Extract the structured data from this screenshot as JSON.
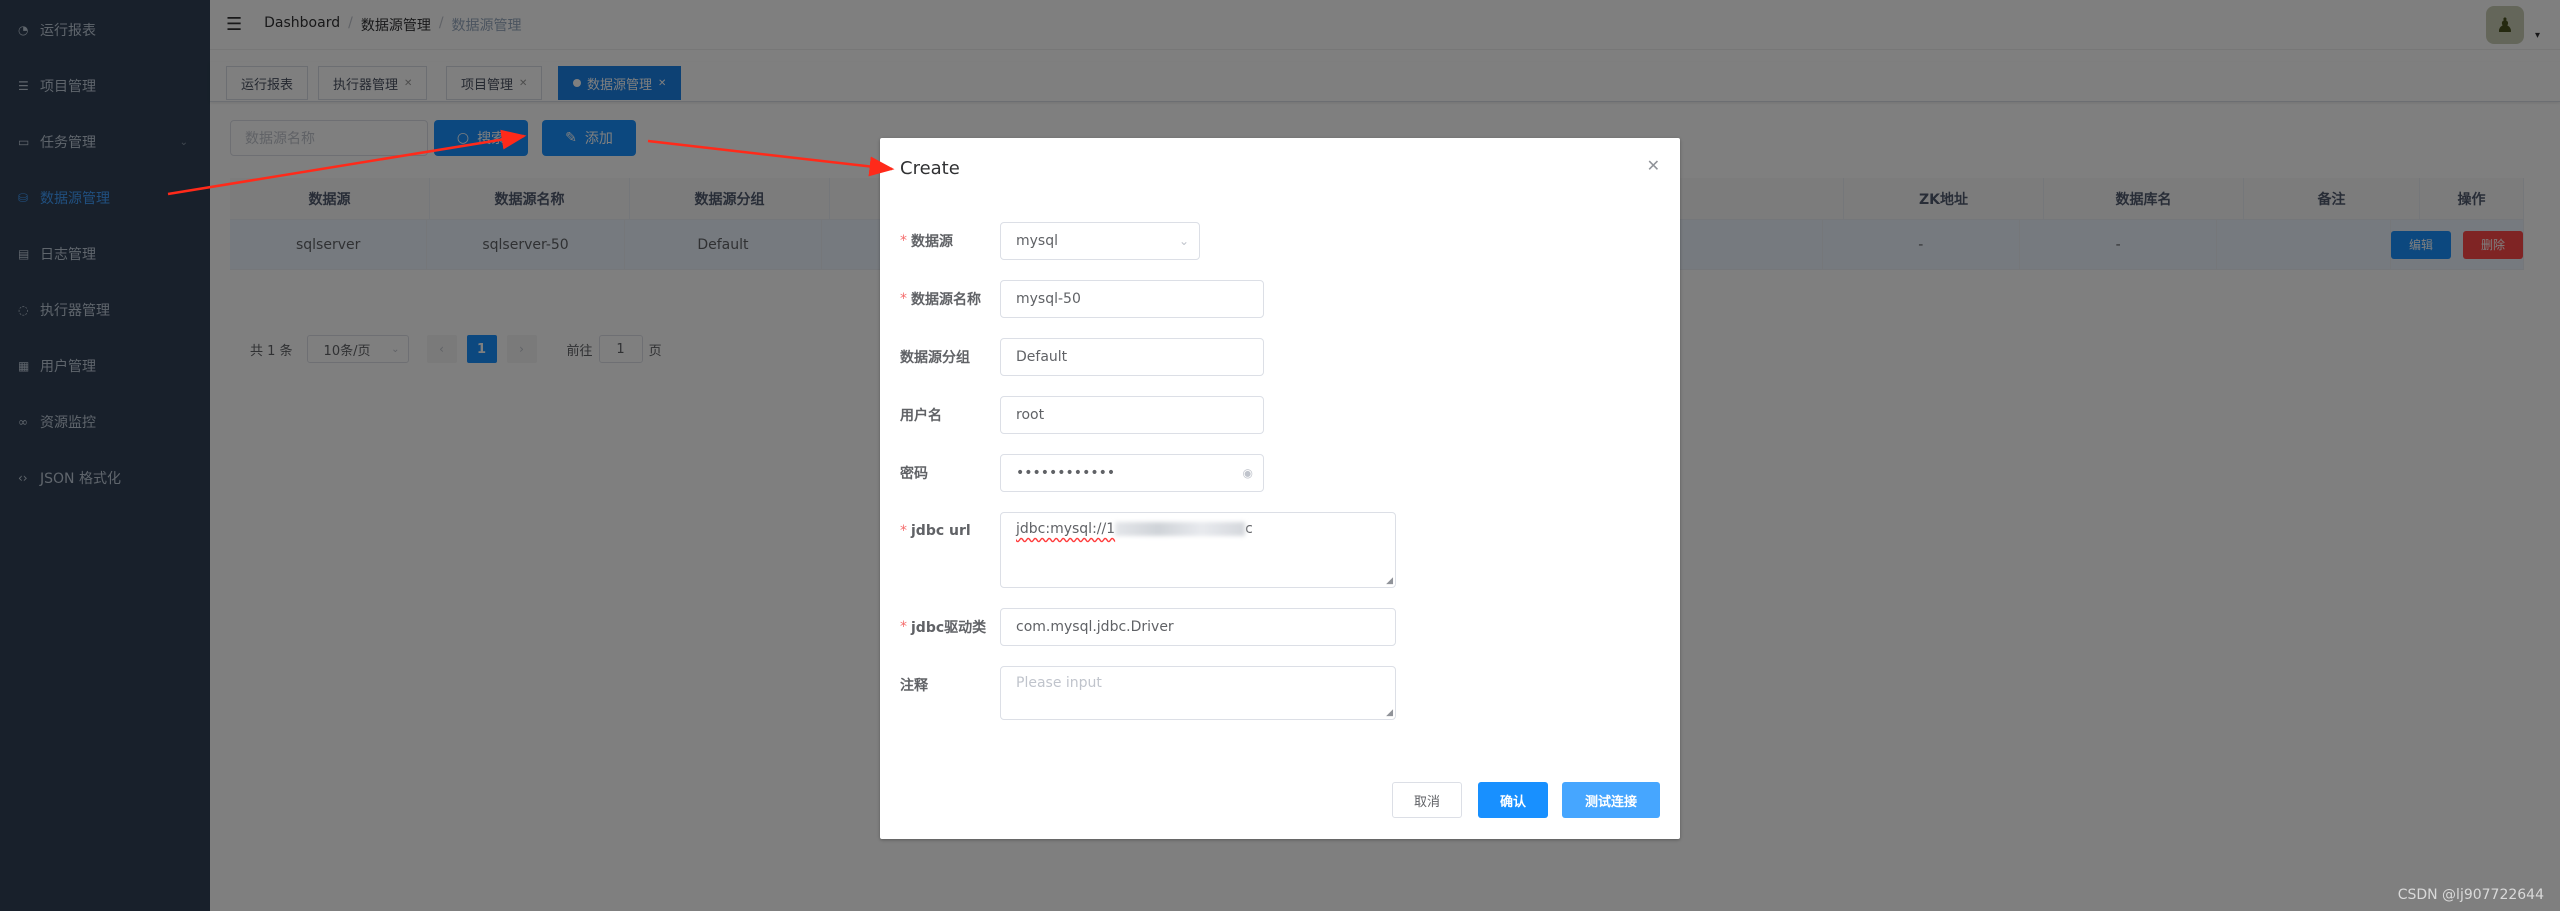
{
  "sidebar": {
    "items": [
      {
        "label": "运行报表",
        "icon": "dashboard-icon"
      },
      {
        "label": "项目管理",
        "icon": "database-icon"
      },
      {
        "label": "任务管理",
        "icon": "monitor-icon"
      },
      {
        "label": "数据源管理",
        "icon": "datasource-icon"
      },
      {
        "label": "日志管理",
        "icon": "log-icon"
      },
      {
        "label": "执行器管理",
        "icon": "executor-icon"
      },
      {
        "label": "用户管理",
        "icon": "user-table-icon"
      },
      {
        "label": "资源监控",
        "icon": "link-icon"
      },
      {
        "label": "JSON 格式化",
        "icon": "code-icon"
      }
    ],
    "active_index": 3
  },
  "header": {
    "breadcrumb": [
      "Dashboard",
      "数据源管理",
      "数据源管理"
    ]
  },
  "tags": [
    {
      "label": "运行报表"
    },
    {
      "label": "执行器管理"
    },
    {
      "label": "项目管理"
    },
    {
      "label": "数据源管理"
    }
  ],
  "filter": {
    "placeholder": "数据源名称",
    "search_label": "搜索",
    "add_label": "添加"
  },
  "table": {
    "headers": [
      "数据源",
      "数据源名称",
      "数据源分组",
      "ZK地址",
      "数据库名",
      "备注",
      "操作"
    ],
    "rows": [
      {
        "datasource": "sqlserver",
        "name": "sqlserver-50",
        "group": "Default",
        "zk": "-",
        "db": "-",
        "remark": ""
      }
    ],
    "edit_label": "编辑",
    "delete_label": "删除"
  },
  "pagination": {
    "total": "共 1 条",
    "page_size": "10条/页",
    "current_page": "1",
    "goto_prefix": "前往",
    "goto_value": "1",
    "goto_suffix": "页"
  },
  "dialog": {
    "title": "Create",
    "fields": {
      "datasource": {
        "label": "数据源",
        "value": "mysql",
        "required": true
      },
      "name": {
        "label": "数据源名称",
        "value": "mysql-50",
        "required": true
      },
      "group": {
        "label": "数据源分组",
        "value": "Default",
        "required": false
      },
      "username": {
        "label": "用户名",
        "value": "root",
        "required": false
      },
      "password": {
        "label": "密码",
        "value": "••••••••••••",
        "required": false
      },
      "jdbc_url": {
        "label": "jdbc url",
        "value_visible": "jdbc:mysql://1",
        "value_tail": "c",
        "required": true
      },
      "driver": {
        "label": "jdbc驱动类",
        "value": "com.mysql.jdbc.Driver",
        "required": true
      },
      "comment": {
        "label": "注释",
        "placeholder": "Please input",
        "required": false
      }
    },
    "cancel_label": "取消",
    "confirm_label": "确认",
    "test_label": "测试连接"
  },
  "watermark": "CSDN @lj907722644",
  "colors": {
    "sidebar_bg": "#304156",
    "primary": "#1890ff",
    "danger": "#ff4949",
    "arrow": "#ff2a1a"
  }
}
